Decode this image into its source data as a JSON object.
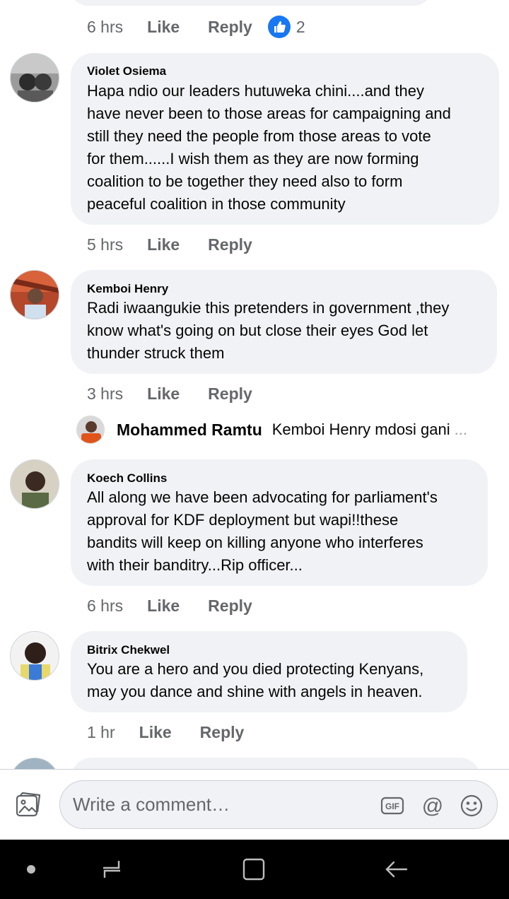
{
  "prev_comment": {
    "time": "6 hrs",
    "like_label": "Like",
    "reply_label": "Reply",
    "reaction_count": "2"
  },
  "comments": [
    {
      "author": "Violet Osiema",
      "lines": [
        "Hapa ndio our leaders hutuweka chini....and they",
        "have never been to those areas for campaigning and",
        "still they need the people from those areas to vote",
        "for them......I wish them as they are now forming",
        "coalition to be together they need also to form",
        "peaceful coalition in those community"
      ],
      "time": "5 hrs",
      "like_label": "Like",
      "reply_label": "Reply"
    },
    {
      "author": "Kemboi Henry",
      "lines": [
        "Radi iwaangukie this pretenders in government ,they",
        "know what's going on but close their eyes God let",
        "thunder struck them"
      ],
      "time": "3 hrs",
      "like_label": "Like",
      "reply_label": "Reply",
      "reply_preview": {
        "author": "Mohammed Ramtu",
        "text": "Kemboi Henry mdosi gani",
        "more": "..."
      }
    },
    {
      "author": "Koech Collins",
      "lines": [
        "All along we have been advocating for parliament's",
        "approval for KDF deployment but wapi!!these",
        "bandits will keep on killing anyone who interferes",
        "with their banditry...Rip officer..."
      ],
      "time": "6 hrs",
      "like_label": "Like",
      "reply_label": "Reply"
    },
    {
      "author": "Bitrix Chekwel",
      "lines": [
        "You are a hero and you died protecting Kenyans,",
        "may you dance and shine with angels in heaven."
      ],
      "time": "1 hr",
      "like_label": "Like",
      "reply_label": "Reply"
    }
  ],
  "composer": {
    "placeholder": "Write a comment…",
    "icons": [
      "photo-icon",
      "gif-icon",
      "mention-icon",
      "emoji-icon"
    ]
  },
  "navbar": {
    "icons": [
      "dot-icon",
      "recents-icon",
      "home-icon",
      "back-icon"
    ]
  },
  "colors": {
    "bubble": "#f0f2f5",
    "meta_text": "#65676b",
    "like_blue": "#1877f2",
    "navbar": "#000000"
  }
}
